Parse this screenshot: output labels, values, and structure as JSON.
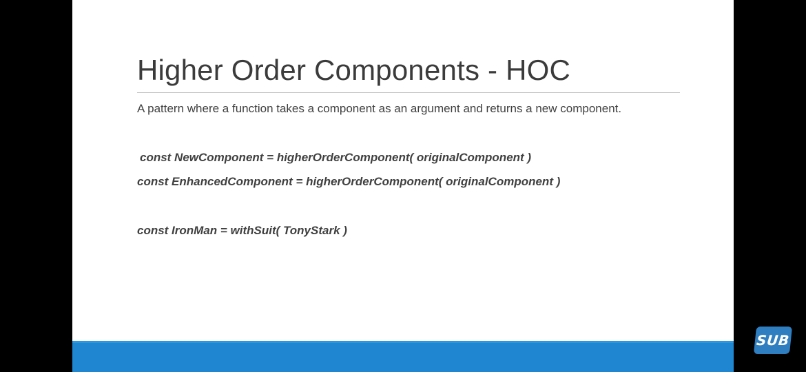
{
  "slide": {
    "title": "Higher Order Components - HOC",
    "subtitle": "A pattern where a function takes a component as an argument and returns a new component.",
    "code_lines": [
      "const NewComponent = higherOrderComponent( originalComponent )",
      "const EnhancedComponent = higherOrderComponent( originalComponent )",
      "const IronMan = withSuit( TonyStark )"
    ]
  },
  "overlay": {
    "sub_badge_label": "SUB",
    "sub_badge_icon": "subscribe-badge-icon"
  },
  "colors": {
    "background": "#000000",
    "slide_background": "#ffffff",
    "accent_bar": "#1f86d1",
    "text": "#404040",
    "badge": "#2f7fc0"
  }
}
